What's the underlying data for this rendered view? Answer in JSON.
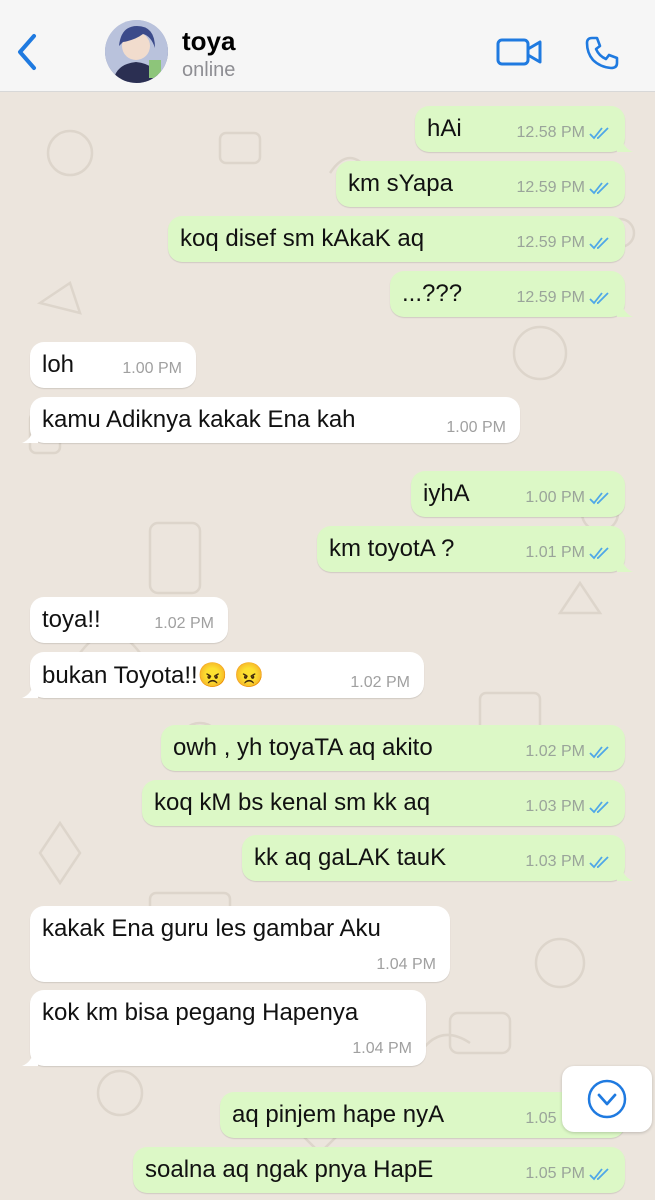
{
  "header": {
    "contact_name": "toya",
    "status": "online",
    "icons": {
      "back": "chevron-left-icon",
      "video": "video-camera-icon",
      "call": "phone-icon"
    },
    "accent_color": "#1f7ae0"
  },
  "colors": {
    "outgoing_bubble": "#dcf8c6",
    "incoming_bubble": "#ffffff",
    "wallpaper": "#ece5dd",
    "read_ticks": "#4fa7e8"
  },
  "messages": [
    {
      "direction": "out",
      "text": "hAi",
      "time": "12.58 PM",
      "read": true
    },
    {
      "direction": "out",
      "text": "km sYapa",
      "time": "12.59 PM",
      "read": true
    },
    {
      "direction": "out",
      "text": "koq disef sm kAkaK aq",
      "time": "12.59 PM",
      "read": true
    },
    {
      "direction": "out",
      "text": "...???",
      "time": "12.59 PM",
      "read": true
    },
    {
      "direction": "in",
      "text": "loh",
      "time": "1.00 PM"
    },
    {
      "direction": "in",
      "text": "kamu Adiknya kakak Ena kah",
      "time": "1.00 PM"
    },
    {
      "direction": "out",
      "text": "iyhA",
      "time": "1.00 PM",
      "read": true
    },
    {
      "direction": "out",
      "text": "km toyotA ?",
      "time": "1.01 PM",
      "read": true
    },
    {
      "direction": "in",
      "text": "toya!!",
      "time": "1.02 PM"
    },
    {
      "direction": "in",
      "text": "bukan Toyota!!😠 😠",
      "time": "1.02 PM"
    },
    {
      "direction": "out",
      "text": "owh , yh toyaTA aq akito",
      "time": "1.02 PM",
      "read": true
    },
    {
      "direction": "out",
      "text": "koq kM bs kenal sm kk aq",
      "time": "1.03 PM",
      "read": true
    },
    {
      "direction": "out",
      "text": "kk aq gaLAK tauK",
      "time": "1.03 PM",
      "read": true
    },
    {
      "direction": "in",
      "text": "kakak Ena guru les gambar Aku",
      "time": "1.04 PM"
    },
    {
      "direction": "in",
      "text": "kok km bisa pegang Hapenya",
      "time": "1.04 PM"
    },
    {
      "direction": "out",
      "text": "aq pinjem hape nyA",
      "time": "1.05 PM",
      "read": true
    },
    {
      "direction": "out",
      "text": "soalna aq ngak pnya HapE",
      "time": "1.05 PM",
      "read": true
    }
  ],
  "scroll_button": {
    "icon": "chevron-down-circle-icon"
  }
}
